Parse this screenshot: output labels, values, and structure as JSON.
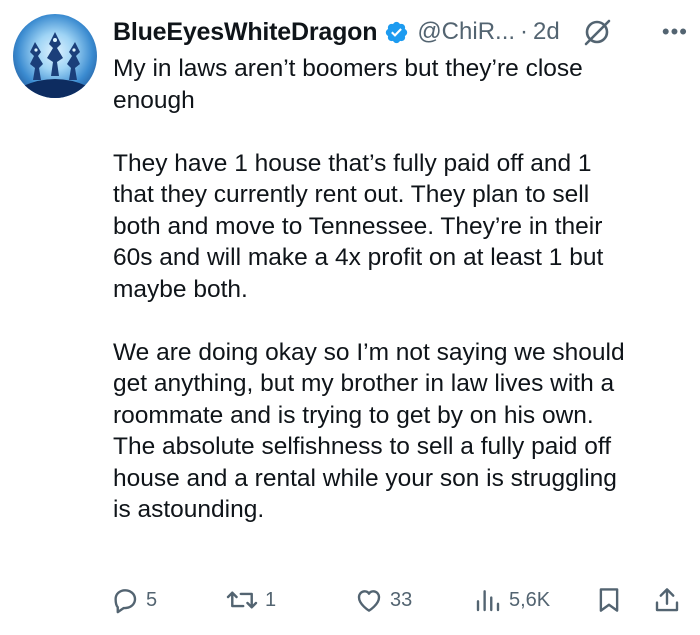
{
  "tweet": {
    "display_name": "BlueEyesWhiteDragon",
    "handle": "@ChiR...",
    "separator": "·",
    "time": "2d",
    "more": "•••",
    "text": "My in laws aren’t boomers but they’re close\nenough\n\nThey have 1 house that’s fully paid off and 1\nthat they currently rent out. They plan to sell\nboth and move to Tennessee. They’re in their\n60s and will make a 4x profit on at least 1 but\nmaybe both.\n\nWe are doing okay so I’m not saying we should\nget anything, but my brother in law lives with a\nroommate and is trying to get by on his own.\nThe absolute selfishness to sell a fully paid off\nhouse and a rental while your son is struggling\nis astounding."
  },
  "actions": {
    "replies": "5",
    "reposts": "1",
    "likes": "33",
    "views": "5,6K"
  },
  "icons": {
    "verified": "verified-badge-icon",
    "grok": "grok-icon",
    "more": "more-icon",
    "reply": "reply-icon",
    "repost": "repost-icon",
    "like": "heart-icon",
    "views": "views-icon",
    "bookmark": "bookmark-icon",
    "share": "share-icon"
  },
  "colors": {
    "text": "#0f1419",
    "secondary": "#536471",
    "verified": "#1d9bf0",
    "background": "#ffffff"
  }
}
